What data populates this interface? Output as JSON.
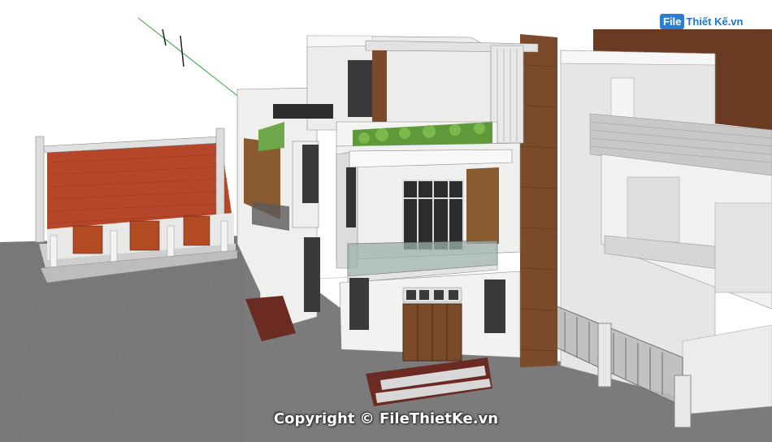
{
  "watermark": {
    "logo_file": "File",
    "logo_rest": "Thiết Kế.vn",
    "copyright": "Copyright © FileThietKe.vn"
  },
  "colors": {
    "ground": "#7a7a7a",
    "roof_tile": "#b5462a",
    "wood": "#7a4a2a",
    "wall_white": "#f2f2f0",
    "plant": "#5f9a3a"
  },
  "scene": {
    "subject": "3D SketchUp render of a three-storey modern townhouse next to a single-storey tiled-roof house and a neighbouring white building"
  }
}
